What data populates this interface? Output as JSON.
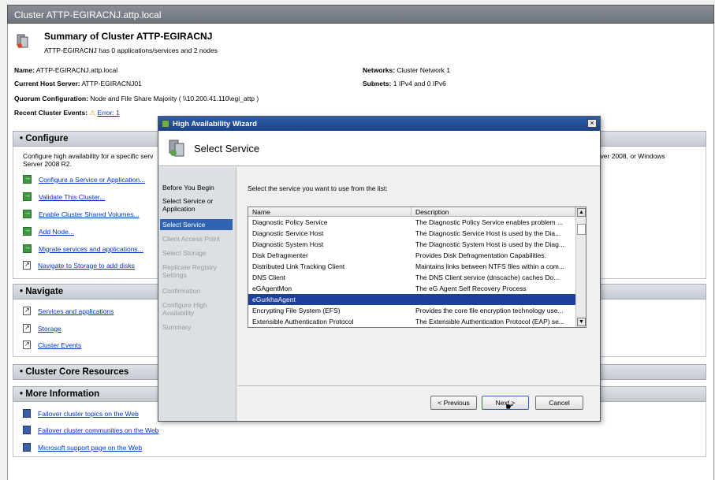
{
  "window": {
    "title": "Cluster ATTP-EGIRACNJ.attp.local"
  },
  "summary": {
    "title": "Summary of Cluster ATTP-EGIRACNJ",
    "subtitle": "ATTP-EGIRACNJ has 0 applications/services and 2 nodes",
    "name_label": "Name:",
    "name_value": "ATTP-EGIRACNJ.attp.local",
    "host_label": "Current Host Server:",
    "host_value": "ATTP-EGIRACNJ01",
    "quorum_label": "Quorum Configuration:",
    "quorum_value": "Node and File Share Majority ( \\\\10.200.41.110\\egi_attp )",
    "events_label": "Recent Cluster Events:",
    "events_value": "Error: 1",
    "networks_label": "Networks:",
    "networks_value": "Cluster Network 1",
    "subnets_label": "Subnets:",
    "subnets_value": "1 IPv4 and 0 IPv6"
  },
  "configure": {
    "header": "Configure",
    "desc_left": "Configure high availability for a specific serv",
    "desc_left2": "Server 2008 R2.",
    "desc_right": "erver 2008, or Windows",
    "links": [
      "Configure a Service or Application...",
      "Validate This Cluster...",
      "Enable Cluster Shared Volumes...",
      "Add Node...",
      "Migrate services and applications...",
      "Navigate to Storage to add disks"
    ]
  },
  "navigate": {
    "header": "Navigate",
    "links": [
      "Services and applications",
      "Storage",
      "Cluster Events"
    ]
  },
  "core": {
    "header": "Cluster Core Resources"
  },
  "more": {
    "header": "More Information",
    "links": [
      "Failover cluster topics on the Web",
      "Failover cluster communities on the Web",
      "Microsoft support page on the Web"
    ]
  },
  "wizard": {
    "title": "High Availability Wizard",
    "close": "×",
    "heading": "Select Service",
    "instruction": "Select the service you want to use from the list:",
    "steps": [
      "Before You Begin",
      "Select Service or Application",
      "Select Service",
      "Client Access Point",
      "Select Storage",
      "Replicate Registry Settings",
      "Confirmation",
      "Configure High Availability",
      "Summary"
    ],
    "columns": [
      "Name",
      "Description"
    ],
    "rows": [
      {
        "name": "Diagnostic Policy Service",
        "desc": "The Diagnostic Policy Service enables problem ..."
      },
      {
        "name": "Diagnostic Service Host",
        "desc": "The Diagnostic Service Host is used by the Dia..."
      },
      {
        "name": "Diagnostic System Host",
        "desc": "The Diagnostic System Host is used by the Diag..."
      },
      {
        "name": "Disk Defragmenter",
        "desc": "Provides Disk Defragmentation Capabilities."
      },
      {
        "name": "Distributed Link Tracking Client",
        "desc": "Maintains links between NTFS files within a com..."
      },
      {
        "name": "DNS Client",
        "desc": "The DNS Client service (dnscache) caches Do..."
      },
      {
        "name": "eGAgentMon",
        "desc": "The eG Agent Self Recovery Process"
      },
      {
        "name": "eGurkhaAgent",
        "desc": ""
      },
      {
        "name": "Encrypting File System (EFS)",
        "desc": "Provides the core file encryption technology use..."
      },
      {
        "name": "Extensible Authentication Protocol",
        "desc": "The Extensible Authentication Protocol (EAP) se..."
      }
    ],
    "selected_index": 7,
    "buttons": {
      "previous": "< Previous",
      "next": "Next >",
      "cancel": "Cancel"
    }
  }
}
